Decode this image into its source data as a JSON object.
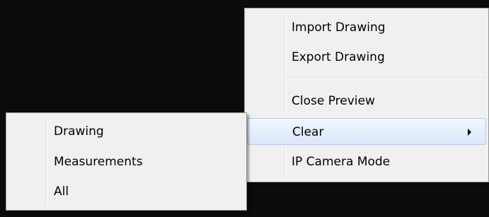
{
  "context_menu": {
    "items": [
      {
        "label": "Import Drawing"
      },
      {
        "label": "Export Drawing"
      },
      {
        "label": "Close Preview"
      },
      {
        "label": "Clear",
        "has_submenu": true,
        "highlighted": true
      },
      {
        "label": "IP Camera Mode"
      }
    ],
    "submenu_arrow_icon": "chevron-right-icon"
  },
  "submenu": {
    "items": [
      {
        "label": "Drawing"
      },
      {
        "label": "Measurements"
      },
      {
        "label": "All"
      }
    ]
  },
  "colors": {
    "background": "#0b0b0b",
    "menu_background": "#f0f0f0",
    "menu_border": "#979797",
    "highlight_border": "#b3cbe9",
    "highlight_fill": "#e5eefb"
  }
}
